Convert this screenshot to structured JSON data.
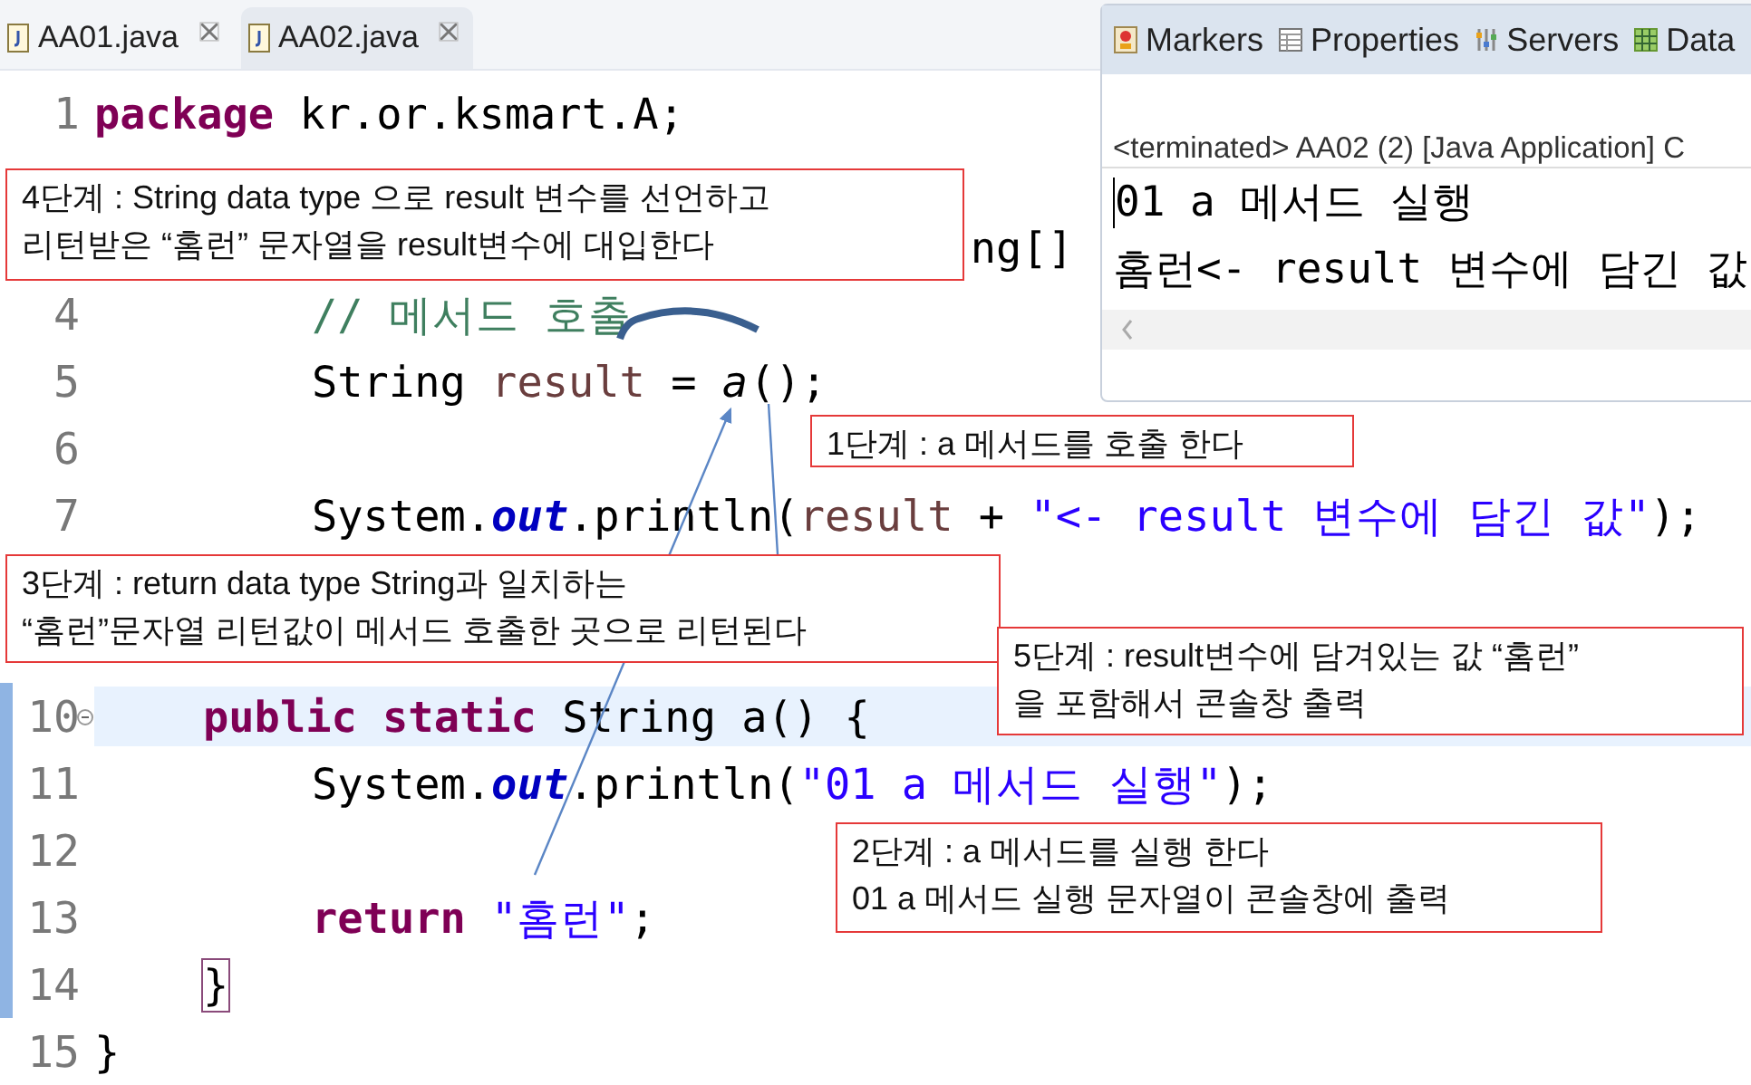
{
  "editor": {
    "tabs": [
      {
        "label": "AA01.java",
        "selected": false
      },
      {
        "label": "AA02.java",
        "selected": true
      }
    ],
    "lines": [
      {
        "number": "1",
        "segments": [
          {
            "kind": "keyword",
            "text": "package"
          },
          {
            "kind": "plain",
            "text": " kr.or.ksmart.A;"
          }
        ]
      },
      {
        "covered": true
      },
      {
        "cut_left": true,
        "segments": [
          {
            "kind": "plain",
            "text": "ng[]"
          }
        ]
      },
      {
        "number": "4",
        "nested": true,
        "segments": [
          {
            "kind": "comment",
            "text": "// 메서드 호출"
          }
        ]
      },
      {
        "number": "5",
        "nested": true,
        "segments": [
          {
            "kind": "plain",
            "text": "String "
          },
          {
            "kind": "local",
            "text": "result"
          },
          {
            "kind": "plain",
            "text": " = "
          },
          {
            "kind": "call",
            "text": "a"
          },
          {
            "kind": "plain",
            "text": "();"
          }
        ]
      },
      {
        "number": "6"
      },
      {
        "number": "7",
        "nested": true,
        "segments": [
          {
            "kind": "plain",
            "text": "System."
          },
          {
            "kind": "field",
            "text": "out"
          },
          {
            "kind": "plain",
            "text": ".println("
          },
          {
            "kind": "local",
            "text": "result"
          },
          {
            "kind": "plain",
            "text": " + "
          },
          {
            "kind": "string",
            "text": "\"<- result 변수에 담긴 값\""
          },
          {
            "kind": "plain",
            "text": ");"
          }
        ]
      },
      {
        "covered": true
      },
      {
        "covered": true
      },
      {
        "number": "10",
        "indented": true,
        "current": true,
        "collapsible": true,
        "changed": true,
        "segments": [
          {
            "kind": "keyword",
            "text": "public static"
          },
          {
            "kind": "plain",
            "text": " String a() {"
          }
        ]
      },
      {
        "number": "11",
        "nested": true,
        "changed": true,
        "segments": [
          {
            "kind": "plain",
            "text": "System."
          },
          {
            "kind": "field",
            "text": "out"
          },
          {
            "kind": "plain",
            "text": ".println("
          },
          {
            "kind": "string",
            "text": "\"01 a 메서드 실행\""
          },
          {
            "kind": "plain",
            "text": ");"
          }
        ]
      },
      {
        "number": "12",
        "changed": true
      },
      {
        "number": "13",
        "nested": true,
        "changed": true,
        "segments": [
          {
            "kind": "keyword",
            "text": "return"
          },
          {
            "kind": "string",
            "text": " \"홈런\""
          },
          {
            "kind": "plain",
            "text": ";"
          }
        ]
      },
      {
        "number": "14",
        "indented": true,
        "changed": true,
        "segments": [
          {
            "kind": "bracket",
            "text": "}"
          }
        ]
      },
      {
        "number": "15",
        "segments": [
          {
            "kind": "plain",
            "text": "}"
          }
        ]
      }
    ]
  },
  "console": {
    "tabs": [
      {
        "label": "Markers",
        "kind": "markers"
      },
      {
        "label": "Properties",
        "kind": "properties"
      },
      {
        "label": "Servers",
        "kind": "servers"
      },
      {
        "label": "Data",
        "kind": "data"
      }
    ],
    "status": "<terminated> AA02 (2) [Java Application] C",
    "output": [
      "01 a 메서드 실행",
      "홈런<- result 변수에 담긴 값"
    ]
  },
  "callouts": [
    {
      "text": "4단계 : String data type 으로 result 변수를 선언하고\n리턴받은 “홈런” 문자열을 result변수에 대입한다"
    },
    {
      "text": "1단계 : a 메서드를 호출 한다"
    },
    {
      "text": "3단계 : return data type String과 일치하는\n“홈런”문자열 리턴값이 메서드 호출한 곳으로 리턴된다"
    },
    {
      "text": "5단계 : result변수에 담겨있는 값 “홈런”\n을 포함해서 콘솔창 출력"
    },
    {
      "text": "2단계 : a 메서드를 실행 한다\n01 a 메서드 실행 문자열이 콘솔창에 출력"
    }
  ]
}
